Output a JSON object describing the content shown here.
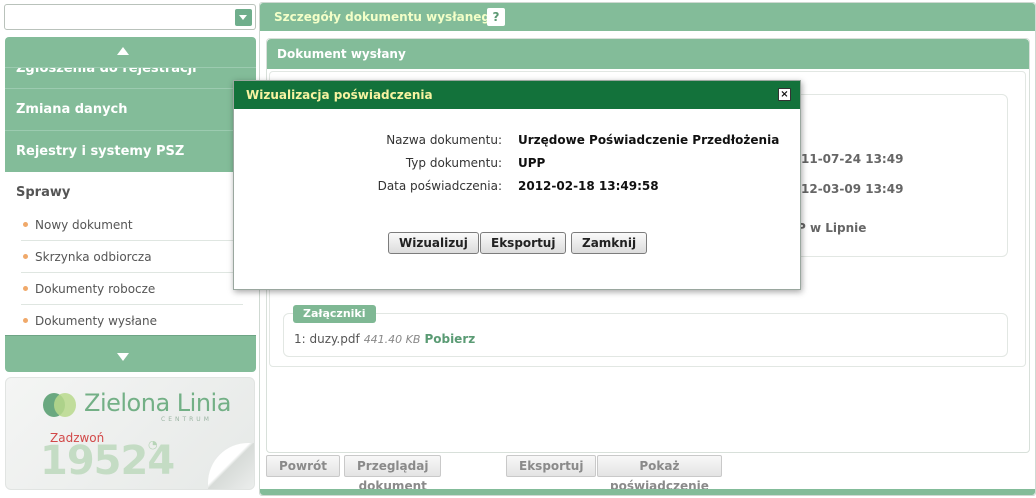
{
  "search": {
    "value": "",
    "placeholder": ""
  },
  "nav": {
    "groups": [
      "Zgłoszenia do rejestracji",
      "Zmiana danych",
      "Rejestry i systemy PSZ"
    ],
    "section": "Sprawy",
    "items": [
      "Nowy dokument",
      "Skrzynka odbiorcza",
      "Dokumenty robocze",
      "Dokumenty wysłane"
    ]
  },
  "promo": {
    "logo": "Zielona Linia",
    "logo_sub": "CENTRUM",
    "call": "Zadzwoń",
    "number": "19524"
  },
  "main": {
    "title": "Szczegóły dokumentu wysłanego",
    "help": "?",
    "doc_title": "Dokument wysłany",
    "peek": [
      "11-07-24 13:49",
      "12-03-09 13:49",
      "P w Lipnie"
    ],
    "attachments": {
      "label": "Załączniki",
      "file": "1: duzy.pdf",
      "size": "441.40 KB",
      "download": "Pobierz"
    },
    "buttons": [
      "Powrót",
      "Przeglądaj dokument",
      "Eksportuj",
      "Pokaż poświadczenie przedłożenia"
    ]
  },
  "modal": {
    "title": "Wizualizacja poświadczenia",
    "close": "×",
    "fields": [
      {
        "label": "Nazwa dokumentu:",
        "value": "Urzędowe Poświadczenie Przedłożenia"
      },
      {
        "label": "Typ dokumentu:",
        "value": "UPP"
      },
      {
        "label": "Data poświadczenia:",
        "value": "2012-02-18 13:49:58"
      }
    ],
    "buttons": [
      "Wizualizuj",
      "Eksportuj",
      "Zamknij"
    ]
  },
  "colors": {
    "accent": "#83bc99",
    "modal_header": "#13723b",
    "modal_title": "#f7f3a1",
    "bullet": "#f0a96a"
  }
}
